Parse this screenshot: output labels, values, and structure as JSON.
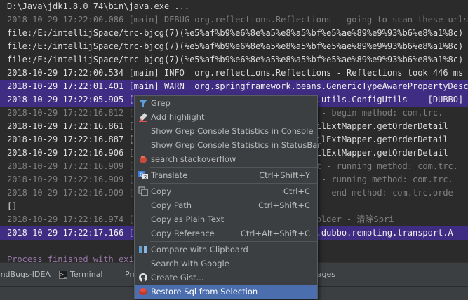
{
  "console": {
    "lines": [
      {
        "style": "plain",
        "segs": [
          {
            "t": "D:\\Java\\jdk1.8.0_74\\bin\\java.exe ...",
            "c": "#dcdcdc"
          }
        ]
      },
      {
        "style": "plain",
        "segs": [
          {
            "t": "2018-10-29 17:22:00.086 [main] DEBUG org.reflections.Reflections - going to scan these urls:",
            "c": "#808080"
          }
        ]
      },
      {
        "style": "plain",
        "segs": [
          {
            "t": "file:/E:/intellijSpace/trc-bjcg(7)(%e5%af%b9%e6%8e%a5%e8%a5%bf%e5%ae%89%e9%93%b6%e8%a1%8c)",
            "c": "#dcdcdc"
          }
        ]
      },
      {
        "style": "plain",
        "segs": [
          {
            "t": "file:/E:/intellijSpace/trc-bjcg(7)(%e5%af%b9%e6%8e%a5%e8%a5%bf%e5%ae%89%e9%93%b6%e8%a1%8c)",
            "c": "#dcdcdc"
          }
        ]
      },
      {
        "style": "plain",
        "segs": [
          {
            "t": "file:/E:/intellijSpace/trc-bjcg(7)(%e5%af%b9%e6%8e%a5%e8%a5%bf%e5%ae%89%e9%93%b6%e8%a1%8c)",
            "c": "#dcdcdc"
          }
        ]
      },
      {
        "style": "plain",
        "segs": [
          {
            "t": "2018-10-29 17:22:00.534 [main] INFO  org.reflections.Reflections - Reflections took 446 ms",
            "c": "#dcdcdc"
          }
        ]
      },
      {
        "style": "hl",
        "segs": [
          {
            "t": "2018-10-29 17:22:01.401 [main] WARN  org.springframework.beans.GenericTypeAwarePropertyDescriptor",
            "c": "#f0f0f0"
          }
        ]
      },
      {
        "style": "hl",
        "segs": [
          {
            "t": "2018-10-29 17:22:05.905 [main] WARN  com.alibaba.dubbo.common.utils.ConfigUtils -  [DUBBO]",
            "c": "#f0f0f0"
          }
        ]
      },
      {
        "style": "plain",
        "segs": [
          {
            "t": "2018-10-29 17:22:16.812 [main] DEBUG com.trc.aspect.LogAspect - begin method: com.trc.",
            "c": "#808080"
          }
        ]
      },
      {
        "style": "plain",
        "segs": [
          {
            "t": "2018-10-29 17:22:16.861 [main] DEBUG com.trc.mapper.OrderDetailExtMapper.getOrderDetail",
            "c": "#dcdcdc"
          }
        ]
      },
      {
        "style": "plain",
        "segs": [
          {
            "t": "2018-10-29 17:22:16.887 [main] DEBUG com.trc.mapper.OrderDetailExtMapper.getOrderDetail",
            "c": "#dcdcdc"
          }
        ]
      },
      {
        "style": "plain",
        "segs": [
          {
            "t": "2018-10-29 17:22:16.906 [main] DEBUG com.trc.mapper.OrderDetailExtMapper.getOrderDetail",
            "c": "#dcdcdc"
          }
        ]
      },
      {
        "style": "plain",
        "segs": [
          {
            "t": "2018-10-29 17:22:16.909 [main] DEBUG com.trc.aspect.TimeAspect - running method: com.trc.",
            "c": "#808080"
          }
        ]
      },
      {
        "style": "plain",
        "segs": [
          {
            "t": "2018-10-29 17:22:16.909 [main] DEBUG com.trc.aspect.LogAspect - running method: com.trc.",
            "c": "#808080"
          }
        ]
      },
      {
        "style": "plain",
        "segs": [
          {
            "t": "2018-10-29 17:22:16.909 [main] DEBUG com.trc.aspect.LogAspect - end method: com.trc.orde",
            "c": "#808080"
          }
        ]
      },
      {
        "style": "plain",
        "segs": [
          {
            "t": "[]",
            "c": "#dcdcdc"
          }
        ]
      },
      {
        "style": "plain",
        "segs": [
          {
            "t": "2018-10-29 17:22:16.974 [Thread-1] INFO  o.s.c.SpringContextHolder - 清除Spri",
            "c": "#808080"
          }
        ]
      },
      {
        "style": "hl",
        "segs": [
          {
            "t": "2018-10-29 17:22:17.166 [DubboShutdownHook] WARN  com.alibaba.dubbo.remoting.transport.A",
            "c": "#f0f0f0"
          }
        ]
      },
      {
        "style": "blank",
        "segs": []
      },
      {
        "style": "fin",
        "segs": [
          {
            "t": "Process finished with exit code 0",
            "c": "#9876aa"
          }
        ]
      }
    ]
  },
  "statusbar": {
    "tab1": "FindBugs-IDEA",
    "tab2": "Terminal",
    "tab3": "Problems",
    "tab4": "Messages"
  },
  "menu": {
    "items": [
      {
        "label": "Grep",
        "shortcut": "",
        "icon": "grep-icon"
      },
      {
        "label": "Add highlight",
        "shortcut": "",
        "icon": "highlight-icon"
      },
      {
        "label": "Show Grep Console Statistics in Console",
        "shortcut": "",
        "icon": ""
      },
      {
        "label": "Show Grep Console Statistics in StatusBar",
        "shortcut": "",
        "icon": ""
      },
      {
        "label": "search stackoverflow",
        "shortcut": "",
        "icon": "stackoverflow-icon"
      },
      {
        "label": "Translate",
        "shortcut": "Ctrl+Shift+Y",
        "icon": "translate-icon"
      },
      {
        "label": "Copy",
        "shortcut": "Ctrl+C",
        "icon": "copy-icon"
      },
      {
        "label": "Copy Path",
        "shortcut": "Ctrl+Shift+C",
        "icon": ""
      },
      {
        "label": "Copy as Plain Text",
        "shortcut": "",
        "icon": ""
      },
      {
        "label": "Copy Reference",
        "shortcut": "Ctrl+Alt+Shift+C",
        "icon": ""
      },
      {
        "label": "Compare with Clipboard",
        "shortcut": "",
        "icon": "compare-icon"
      },
      {
        "label": "Search with Google",
        "shortcut": "",
        "icon": ""
      },
      {
        "label": "Create Gist...",
        "shortcut": "",
        "icon": "github-icon"
      },
      {
        "label": "Restore Sql from Selection",
        "shortcut": "",
        "icon": "sql-icon"
      }
    ],
    "selected_index": 13,
    "accent": "#4b6eaf"
  },
  "colors": {
    "console_bg": "#2b2b2b",
    "highlight_bg": "#3f2d83",
    "menu_bg": "#3c3f41"
  }
}
